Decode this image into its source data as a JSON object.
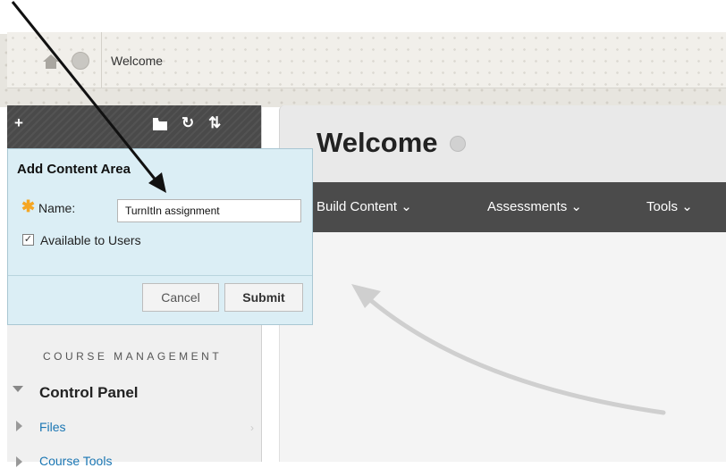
{
  "breadcrumb": {
    "label": "Welcome"
  },
  "left_toolbar": {
    "add": "+",
    "refresh": "↻",
    "sort": "⇅",
    "folder_icon": "folder-icon"
  },
  "popup": {
    "title": "Add Content Area",
    "name_label": "Name:",
    "name_value": "TurnItIn assignment",
    "available_label": "Available to Users",
    "available_checked": true,
    "cancel_label": "Cancel",
    "submit_label": "Submit"
  },
  "page": {
    "title": "Welcome",
    "menu": [
      {
        "label": "Build Content"
      },
      {
        "label": "Assessments"
      },
      {
        "label": "Tools"
      }
    ]
  },
  "course_management": {
    "heading": "COURSE MANAGEMENT",
    "control_panel": "Control Panel",
    "files": "Files",
    "course_tools": "Course Tools"
  },
  "colors": {
    "accent_link": "#1a76b3",
    "menubar": "#4b4b4b",
    "popup_bg": "#dbeef5",
    "required_star": "#f5a623"
  }
}
